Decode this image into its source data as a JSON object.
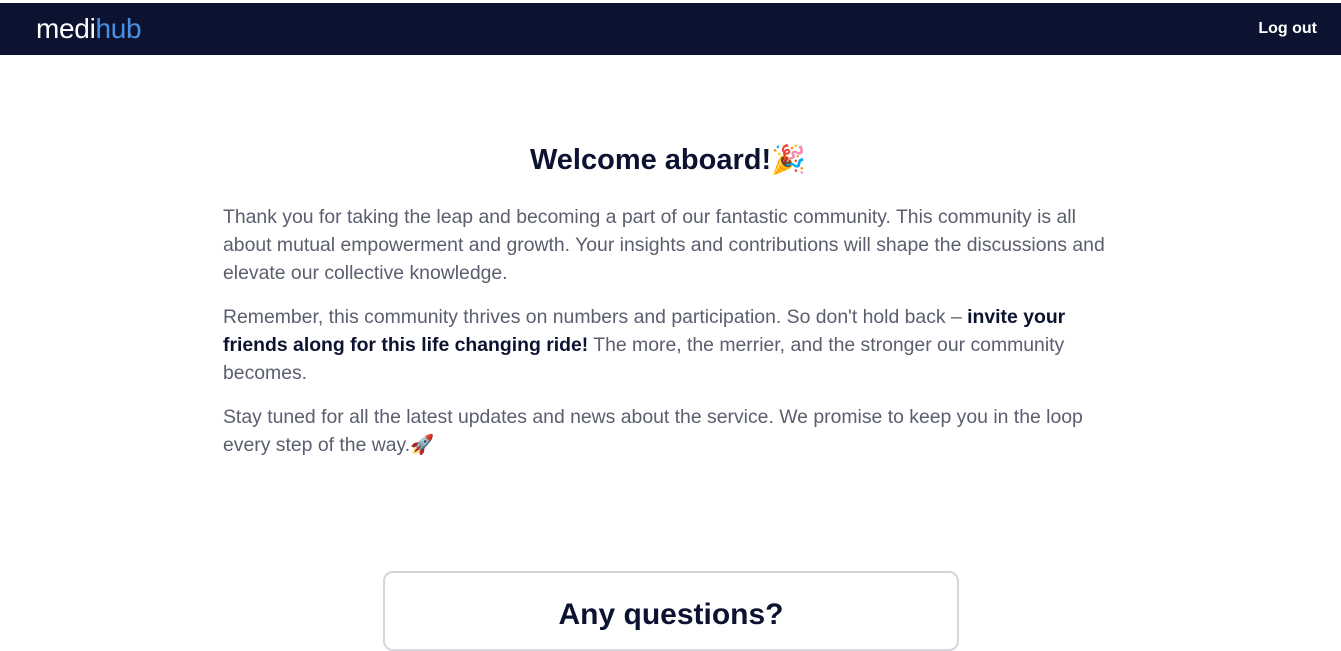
{
  "header": {
    "logo_primary": "medi",
    "logo_accent": "hub",
    "logout_label": "Log out"
  },
  "welcome": {
    "title": "Welcome aboard!",
    "title_emoji": "🎉",
    "para1": "Thank you for taking the leap and becoming a part of our fantastic community. This community is all about mutual empowerment and growth. Your insights and contributions will shape the discussions and elevate our collective knowledge.",
    "para2_start": "Remember, this community thrives on numbers and participation. So don't hold back – ",
    "para2_bold": "invite your friends along for this life changing ride!",
    "para2_end": " The more, the merrier, and the stronger our community becomes.",
    "para3": "Stay tuned for all the latest updates and news about the service. We promise to keep you in the loop every step of the way.",
    "para3_emoji": "🚀"
  },
  "questions": {
    "title": "Any questions?"
  },
  "colors": {
    "navbar_bg": "#0c1330",
    "logo_accent": "#4a90e2",
    "body_text": "#5a5e6e",
    "heading_text": "#0c1330"
  }
}
